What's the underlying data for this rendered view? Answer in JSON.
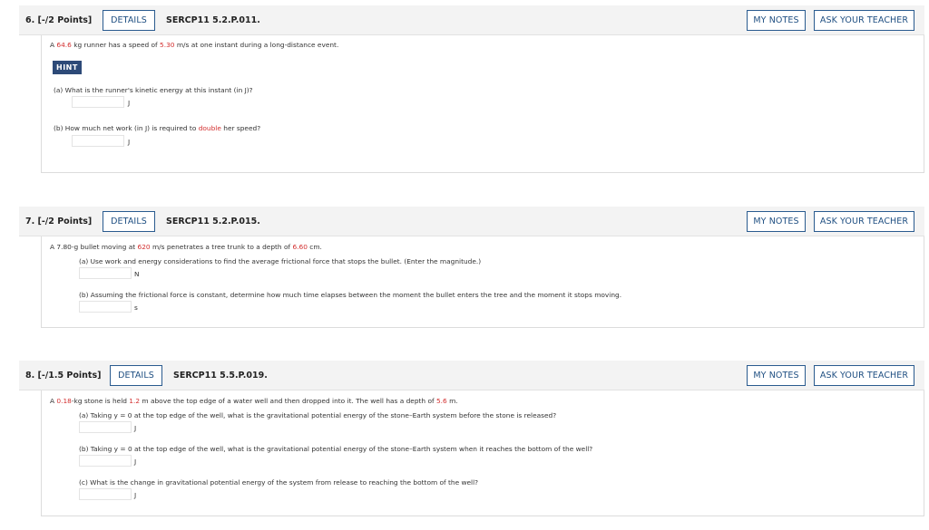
{
  "questions": [
    {
      "number": "6. [-/2 Points]",
      "details_label": "DETAILS",
      "code": "SERCP11 5.2.P.011.",
      "notes_label": "MY NOTES",
      "ask_label": "ASK YOUR TEACHER",
      "stem_parts": [
        "A ",
        "64.6",
        " kg runner has a speed of ",
        "5.30",
        " m/s at one instant during a long-distance event."
      ],
      "hint_label": "HINT",
      "parts": [
        {
          "prompt": "(a)   What is the runner's kinetic energy at this instant (in J)?",
          "unit": "J",
          "value": ""
        },
        {
          "prompt_parts": [
            "(b)   How much net work (in J) is required to ",
            "double",
            " her speed?"
          ],
          "unit": "J",
          "value": ""
        }
      ]
    },
    {
      "number": "7. [-/2 Points]",
      "details_label": "DETAILS",
      "code": "SERCP11 5.2.P.015.",
      "notes_label": "MY NOTES",
      "ask_label": "ASK YOUR TEACHER",
      "stem_parts": [
        "A 7.80-g bullet moving at ",
        "620",
        " m/s penetrates a tree trunk to a depth of ",
        "6.60",
        " cm."
      ],
      "parts": [
        {
          "prompt": "(a) Use work and energy considerations to find the average frictional force that stops the bullet. (Enter the magnitude.)",
          "unit": "N",
          "value": ""
        },
        {
          "prompt": "(b) Assuming the frictional force is constant, determine how much time elapses between the moment the bullet enters the tree and the moment it stops moving.",
          "unit": "s",
          "value": ""
        }
      ]
    },
    {
      "number": "8. [-/1.5 Points]",
      "details_label": "DETAILS",
      "code": "SERCP11 5.5.P.019.",
      "notes_label": "MY NOTES",
      "ask_label": "ASK YOUR TEACHER",
      "stem_parts": [
        "A ",
        "0.18",
        "-kg stone is held ",
        "1.2",
        " m above the top edge of a water well and then dropped into it. The well has a depth of ",
        "5.6",
        " m."
      ],
      "parts": [
        {
          "prompt": "(a) Taking y = 0 at the top edge of the well, what is the gravitational potential energy of the stone–Earth system before the stone is released?",
          "unit": "J",
          "value": ""
        },
        {
          "prompt": "(b) Taking y = 0 at the top edge of the well, what is the gravitational potential energy of the stone–Earth system when it reaches the bottom of the well?",
          "unit": "J",
          "value": ""
        },
        {
          "prompt": "(c) What is the change in gravitational potential energy of the system from release to reaching the bottom of the well?",
          "unit": "J",
          "value": ""
        }
      ]
    }
  ],
  "colors": {
    "accent": "#1f4f82",
    "highlight": "#d32f2f",
    "hint_bg": "#2d4a78"
  }
}
